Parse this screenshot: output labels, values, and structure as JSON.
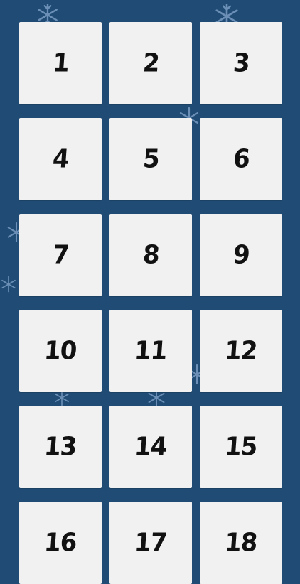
{
  "calendar": {
    "days": [
      {
        "label": "1"
      },
      {
        "label": "2"
      },
      {
        "label": "3"
      },
      {
        "label": "4"
      },
      {
        "label": "5"
      },
      {
        "label": "6"
      },
      {
        "label": "7"
      },
      {
        "label": "8"
      },
      {
        "label": "9"
      },
      {
        "label": "10"
      },
      {
        "label": "11"
      },
      {
        "label": "12"
      },
      {
        "label": "13"
      },
      {
        "label": "14"
      },
      {
        "label": "15"
      },
      {
        "label": "16"
      },
      {
        "label": "17"
      },
      {
        "label": "18"
      }
    ]
  },
  "colors": {
    "background": "#1f4b74",
    "tile": "#f1f1f2",
    "number": "#111111",
    "snowflake": "#9bbfe6"
  },
  "icons": {
    "background_decoration": "snowflake-icon"
  }
}
